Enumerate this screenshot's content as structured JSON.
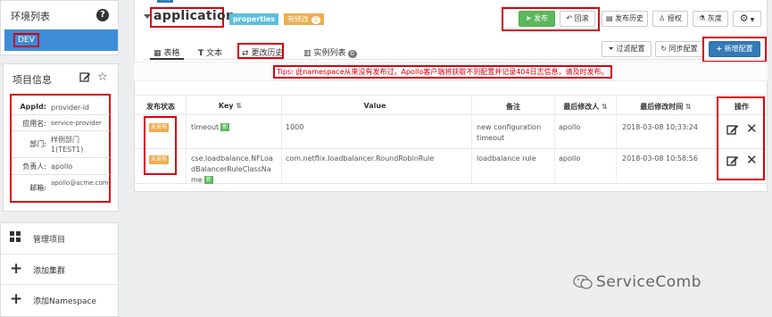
{
  "sidebar": {
    "env_title": "环境列表",
    "env_active": "DEV",
    "project_title": "项目信息",
    "project_fields": [
      {
        "label": "AppId:",
        "value": "provider-id"
      },
      {
        "label": "应用名:",
        "value": "service-provider"
      },
      {
        "label": "部门:",
        "value": "样例部门1(TEST1)"
      },
      {
        "label": "负责人:",
        "value": "apollo"
      },
      {
        "label": "邮箱:",
        "value": "apollo@acme.com"
      }
    ],
    "menu": [
      {
        "icon": "grid-icon",
        "label": "管理项目"
      },
      {
        "icon": "plus-icon",
        "label": "添加集群"
      },
      {
        "icon": "plus-icon",
        "label": "添加Namespace"
      }
    ]
  },
  "namespace": {
    "title": "application",
    "format_badge": "properties",
    "modified_badge": "有修改",
    "modified_count": "2",
    "top_tag": "私有"
  },
  "toolbar": {
    "publish": "发布",
    "rollback": "回滚",
    "history": "发布历史",
    "authorize": "授权",
    "gray": "灰度",
    "settings_icon": "gear-icon",
    "filter": "过滤配置",
    "sync": "同步配置",
    "add": "新增配置"
  },
  "tabs": {
    "table": "表格",
    "text": "文本",
    "history": "更改历史",
    "instances": "实例列表",
    "instances_count": "0"
  },
  "tips": "Tips: 此namespace从来没有发布过，Apollo客户端将获取不到配置并记录404日志信息，请及时发布。",
  "table": {
    "headers": [
      "发布状态",
      "Key",
      "Value",
      "备注",
      "最后修改人",
      "最后修改时间",
      "操作"
    ],
    "rows": [
      {
        "status": "未发布",
        "key": "timeout",
        "new": "新",
        "value": "1000",
        "comment": "new configuration timeout",
        "modifier": "apollo",
        "time": "2018-03-08 10:33:24"
      },
      {
        "status": "未发布",
        "key": "cse.loadbalance.NFLoadBalancerRuleClassName",
        "new": "新",
        "value": "com.netflix.loadbalancer.RoundRobinRule",
        "comment": "loadbalance rule",
        "modifier": "apollo",
        "time": "2018-03-08 10:58:56"
      }
    ]
  },
  "watermark": "ServiceComb",
  "colors": {
    "accent": "#3c8dd6",
    "publish": "#5cb85c",
    "badge_props": "#5bc0de",
    "badge_mod": "#f0ad4e",
    "highlight": "#d8000c"
  }
}
